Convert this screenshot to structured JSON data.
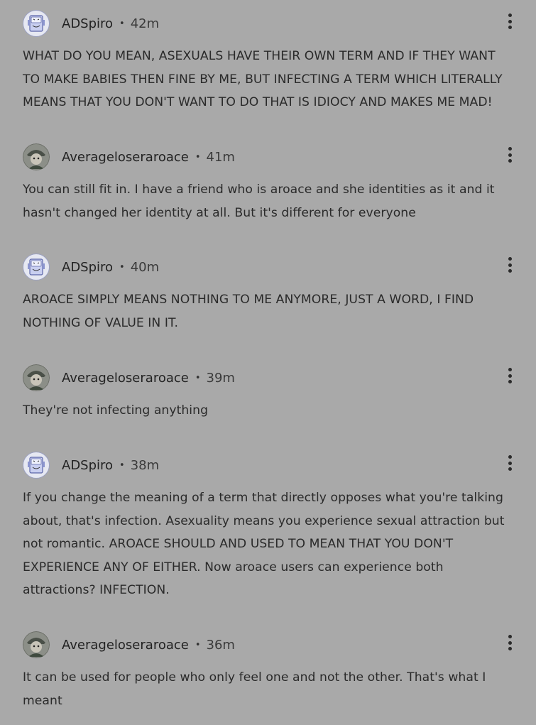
{
  "comments": [
    {
      "author": "ADSpiro",
      "separator": "•",
      "time": "42m",
      "text": "WHAT DO YOU MEAN, ASEXUALS HAVE THEIR OWN TERM AND IF THEY WANT TO MAKE BABIES THEN FINE BY ME, BUT INFECTING A TERM WHICH LITERALLY MEANS THAT YOU DON'T WANT TO DO THAT IS IDIOCY AND MAKES ME MAD!",
      "avatar_icon": "robot-avatar-icon"
    },
    {
      "author": "Averageloseraroace",
      "separator": "•",
      "time": "41m",
      "text": "You can still fit in. I have a friend who is aroace and she identities as it and it hasn't changed her identity at all. But it's different for everyone",
      "avatar_icon": "character-avatar-icon"
    },
    {
      "author": "ADSpiro",
      "separator": "•",
      "time": "40m",
      "text": "AROACE SIMPLY MEANS NOTHING TO ME ANYMORE, JUST A WORD, I FIND NOTHING OF VALUE IN IT.",
      "avatar_icon": "robot-avatar-icon"
    },
    {
      "author": "Averageloseraroace",
      "separator": "•",
      "time": "39m",
      "text": "They're not infecting anything",
      "avatar_icon": "character-avatar-icon"
    },
    {
      "author": "ADSpiro",
      "separator": "•",
      "time": "38m",
      "text": "If you change the meaning of a term that directly opposes what you're talking about, that's infection. Asexuality means you experience sexual attraction but not romantic. AROACE SHOULD AND USED TO MEAN THAT YOU DON'T EXPERIENCE ANY OF EITHER. Now aroace users can experience both attractions? INFECTION.",
      "avatar_icon": "robot-avatar-icon"
    },
    {
      "author": "Averageloseraroace",
      "separator": "•",
      "time": "36m",
      "text": "It can be used for people who only feel one and not the other. That's what I meant",
      "avatar_icon": "character-avatar-icon"
    }
  ],
  "more_icon": "vertical-dots-icon"
}
